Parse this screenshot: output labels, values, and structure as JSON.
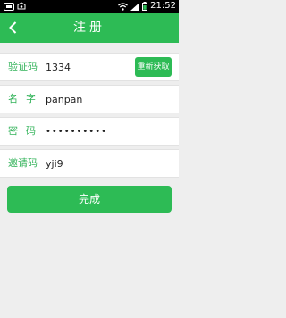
{
  "status_bar": {
    "time": "21:52",
    "left_icons": [
      "notification-icon",
      "app-icon"
    ],
    "right_icons": [
      "wifi-icon",
      "signal-icon",
      "battery-icon"
    ]
  },
  "header": {
    "title": "注册",
    "back_icon": "chevron-left-icon"
  },
  "form": {
    "verification": {
      "label": "验证码",
      "value": "1334",
      "resend_label": "重新获取"
    },
    "name": {
      "label": "名字",
      "value": "panpan"
    },
    "password": {
      "label": "密码",
      "value": "••••••••••"
    },
    "invite": {
      "label": "邀请码",
      "value": "yji9"
    }
  },
  "submit_label": "完成",
  "colors": {
    "accent": "#2dbb55",
    "background": "#eeeeee",
    "label": "#33b35a"
  }
}
